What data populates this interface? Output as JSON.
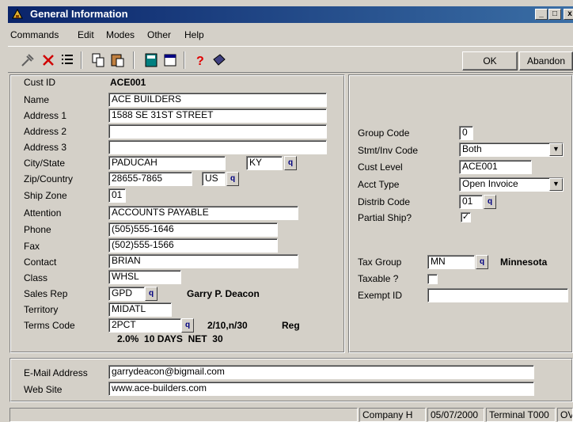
{
  "window": {
    "title": "General Information",
    "buttons": {
      "minimize": "_",
      "maximize": "□",
      "close": "x"
    }
  },
  "menu": {
    "items": [
      "Commands",
      "Edit",
      "Modes",
      "Other",
      "Help"
    ]
  },
  "toolbar": {
    "icons": [
      "hammer-icon",
      "delete-icon",
      "list-icon",
      "copy-icon",
      "paste-icon",
      "calculator-icon",
      "calendar-icon",
      "help-icon",
      "book-icon"
    ],
    "ok_label": "OK",
    "abandon_label": "Abandon"
  },
  "customer": {
    "labels": {
      "cust_id": "Cust ID",
      "name": "Name",
      "address1": "Address 1",
      "address2": "Address 2",
      "address3": "Address 3",
      "city_state": "City/State",
      "zip_country": "Zip/Country",
      "ship_zone": "Ship Zone",
      "attention": "Attention",
      "phone": "Phone",
      "fax": "Fax",
      "contact": "Contact",
      "class": "Class",
      "sales_rep": "Sales Rep",
      "territory": "Territory",
      "terms_code": "Terms Code"
    },
    "values": {
      "cust_id": "ACE001",
      "name": "ACE BUILDERS",
      "address1": "1588 SE 31ST STREET",
      "address2": "",
      "address3": "",
      "city": "PADUCAH",
      "state": "KY",
      "zip": "28655-7865",
      "country": "US",
      "ship_zone": "01",
      "attention": "ACCOUNTS PAYABLE",
      "phone": "(505)555-1646",
      "fax": "(502)555-1566",
      "contact": "BRIAN",
      "class": "WHSL",
      "sales_rep": "GPD",
      "sales_rep_name": "Garry P. Deacon",
      "territory": "MIDATL",
      "terms_code": "2PCT",
      "terms_desc": "2/10,n/30",
      "terms_type": "Reg",
      "terms_detail": "2.0%  10 DAYS  NET  30"
    }
  },
  "billing": {
    "labels": {
      "group_code": "Group Code",
      "stmt_inv_code": "Stmt/Inv Code",
      "cust_level": "Cust Level",
      "acct_type": "Acct Type",
      "distrib_code": "Distrib Code",
      "partial_ship": "Partial Ship?",
      "tax_group": "Tax Group",
      "taxable": "Taxable ?",
      "exempt_id": "Exempt ID"
    },
    "values": {
      "group_code": "0",
      "stmt_inv_code": "Both",
      "cust_level": "ACE001",
      "acct_type": "Open Invoice",
      "distrib_code": "01",
      "partial_ship_check": "✓",
      "tax_group": "MN",
      "tax_group_name": "Minnesota",
      "exempt_id": ""
    }
  },
  "web": {
    "labels": {
      "email": "E-Mail Address",
      "website": "Web Site"
    },
    "values": {
      "email": "garrydeacon@bigmail.com",
      "website": "www.ace-builders.com"
    }
  },
  "status": {
    "company": "Company H",
    "date": "05/07/2000",
    "terminal": "Terminal T000",
    "mode": "OVR"
  }
}
